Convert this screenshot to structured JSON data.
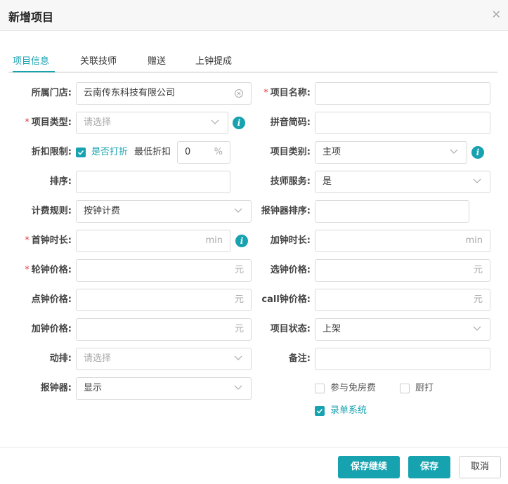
{
  "dialog": {
    "title": "新增项目",
    "close_icon": "close-icon"
  },
  "tabs": [
    {
      "label": "项目信息",
      "active": true
    },
    {
      "label": "关联技师",
      "active": false
    },
    {
      "label": "赠送",
      "active": false
    },
    {
      "label": "上钟提成",
      "active": false
    }
  ],
  "form": {
    "store": {
      "label": "所属门店:",
      "value": "云南传东科技有限公司"
    },
    "item_name": {
      "label": "项目名称:",
      "value": ""
    },
    "item_type": {
      "label": "项目类型:",
      "placeholder": "请选择"
    },
    "pinyin": {
      "label": "拼音简码:",
      "value": ""
    },
    "discount": {
      "label": "折扣限制:",
      "checkbox_label": "是否打折",
      "checked": true,
      "min_label": "最低折扣",
      "min_value": "0",
      "unit": "%"
    },
    "category": {
      "label": "项目类别:",
      "value": "主项"
    },
    "sort": {
      "label": "排序:",
      "value": ""
    },
    "tech_service": {
      "label": "技师服务:",
      "value": "是"
    },
    "billing": {
      "label": "计费规则:",
      "value": "按钟计费"
    },
    "clock_sort": {
      "label": "报钟器排序:",
      "value": ""
    },
    "first_duration": {
      "label": "首钟时长:",
      "unit": "min"
    },
    "add_duration": {
      "label": "加钟时长:",
      "unit": "min"
    },
    "rotation_price": {
      "label": "轮钟价格:",
      "unit": "元"
    },
    "select_price": {
      "label": "选钟价格:",
      "unit": "元"
    },
    "point_price": {
      "label": "点钟价格:",
      "unit": "元"
    },
    "call_price": {
      "label": "call钟价格:",
      "unit": "元"
    },
    "add_price": {
      "label": "加钟价格:",
      "unit": "元"
    },
    "status": {
      "label": "项目状态:",
      "value": "上架"
    },
    "dynamic": {
      "label": "动排:",
      "placeholder": "请选择"
    },
    "remark": {
      "label": "备注:",
      "value": ""
    },
    "clock_device": {
      "label": "报钟器:",
      "value": "显示"
    },
    "free_room": {
      "label": "参与免房费",
      "checked": false
    },
    "kitchen": {
      "label": "厨打",
      "checked": false
    },
    "order_system": {
      "label": "录单系统",
      "checked": true
    }
  },
  "footer": {
    "save_continue": "保存继续",
    "save": "保存",
    "cancel": "取消"
  },
  "colors": {
    "accent": "#17a2b0",
    "required": "#e63a3a"
  }
}
